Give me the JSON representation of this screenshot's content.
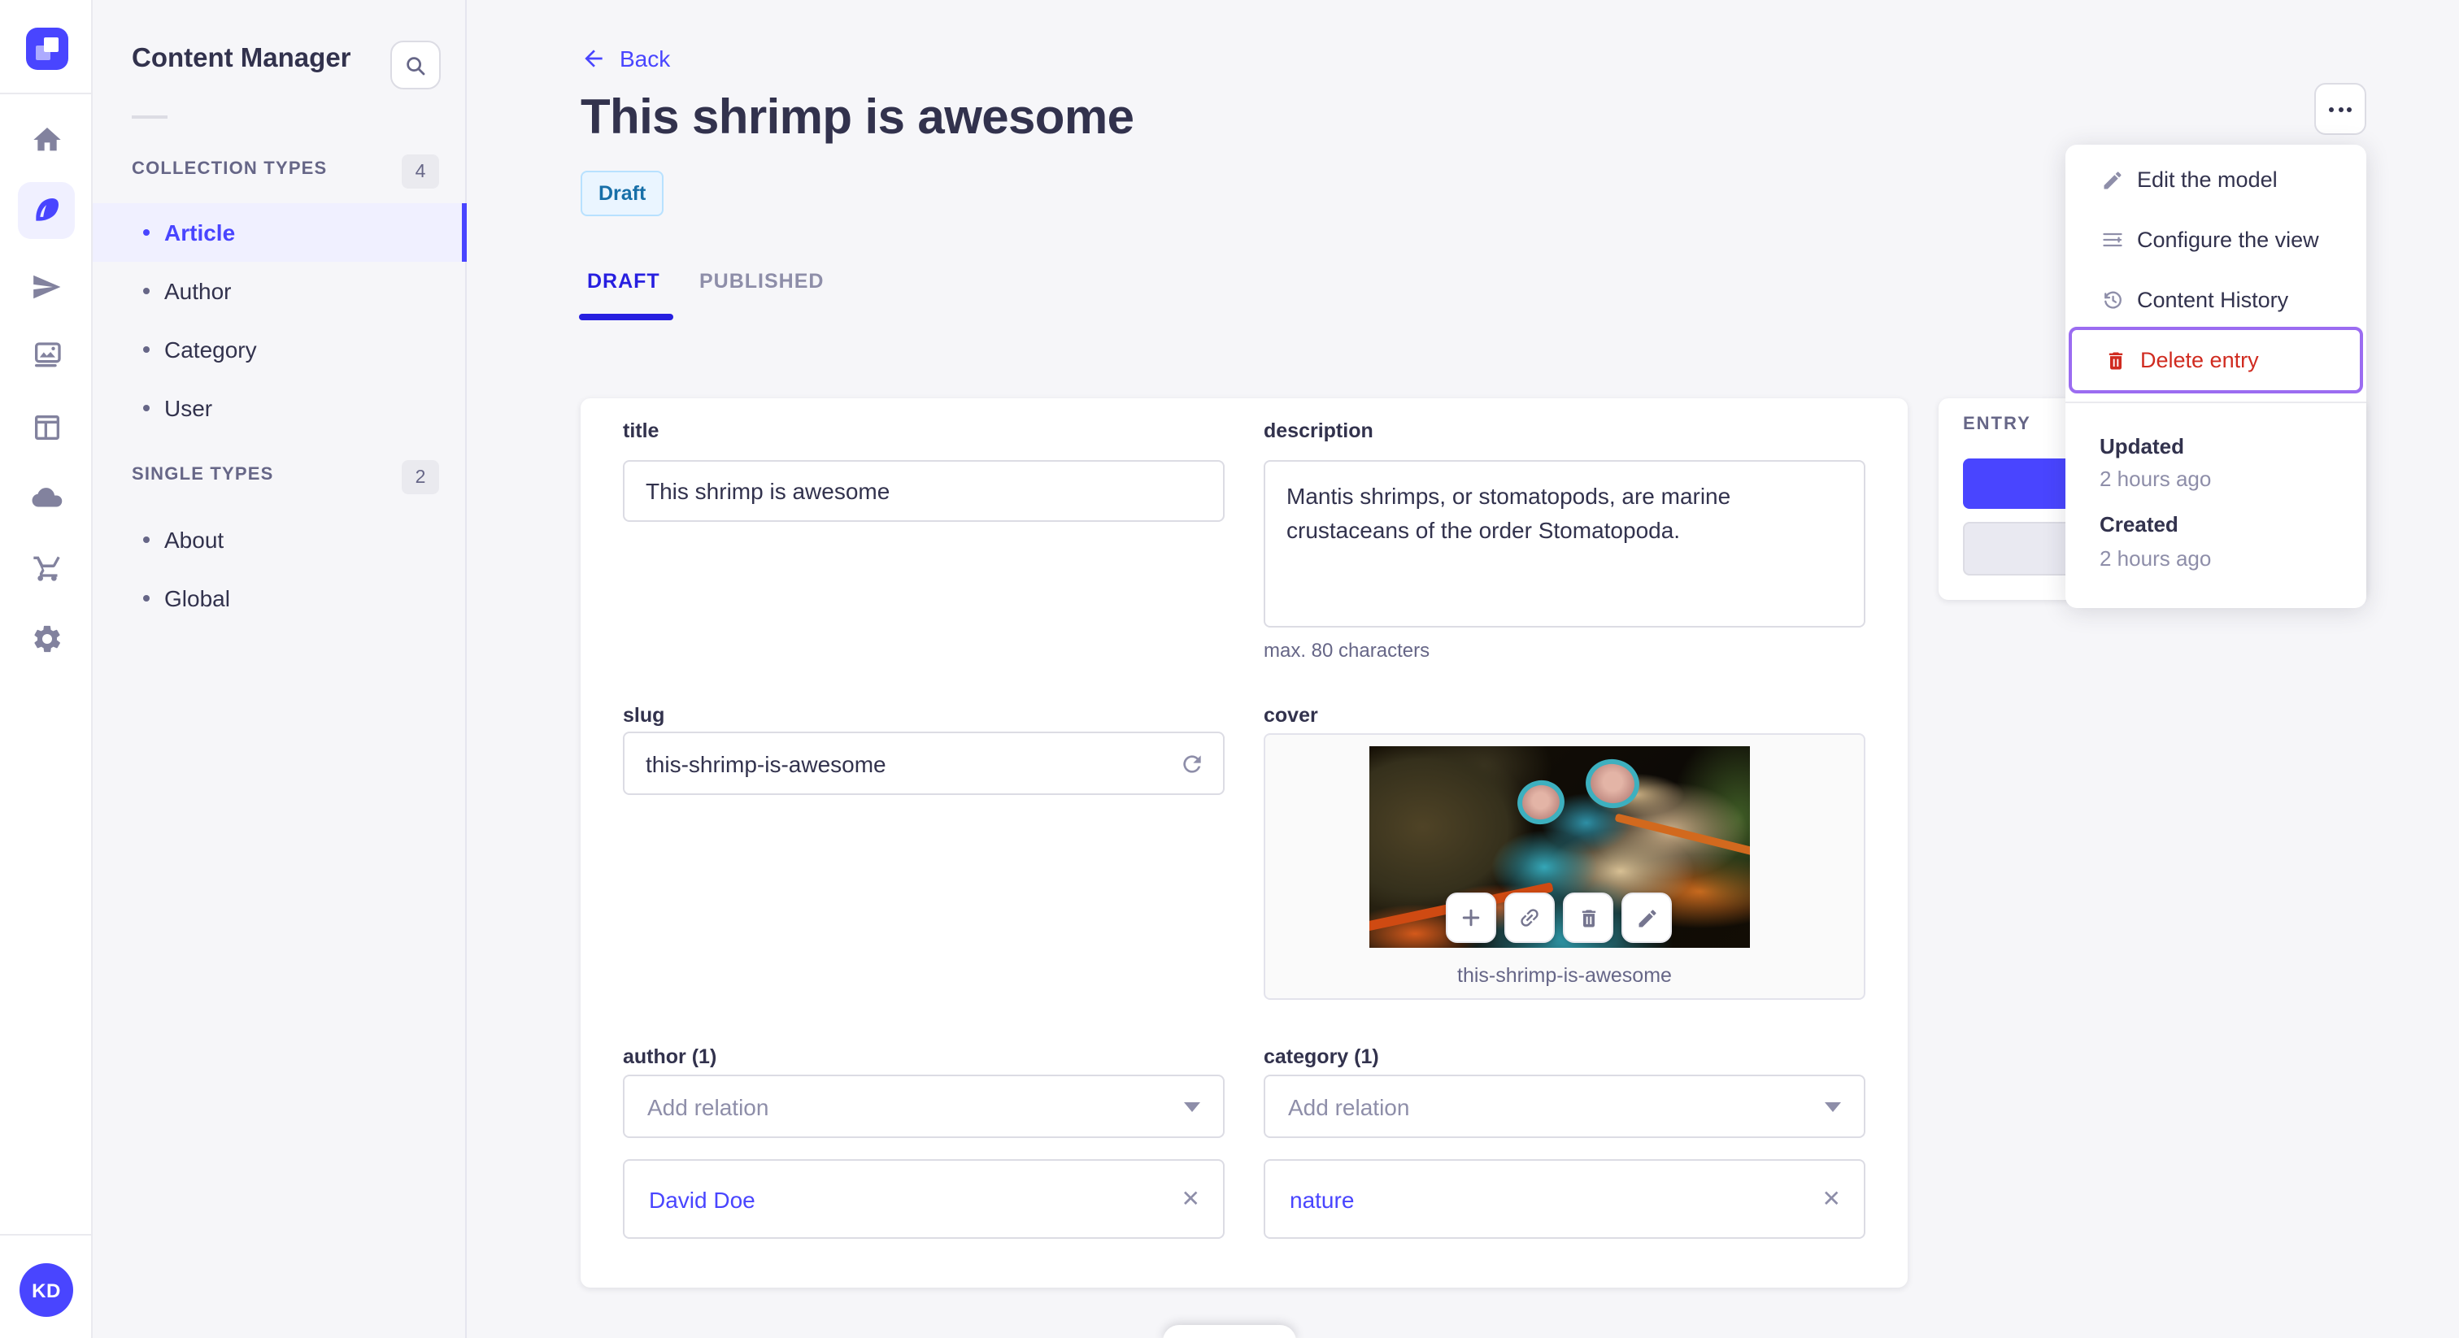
{
  "subnav": {
    "title": "Content Manager",
    "collection": {
      "label": "COLLECTION TYPES",
      "count": "4",
      "items": [
        {
          "label": "Article"
        },
        {
          "label": "Author"
        },
        {
          "label": "Category"
        },
        {
          "label": "User"
        }
      ]
    },
    "single": {
      "label": "SINGLE TYPES",
      "count": "2",
      "items": [
        {
          "label": "About"
        },
        {
          "label": "Global"
        }
      ]
    }
  },
  "header": {
    "back": "Back",
    "title": "This shrimp is awesome",
    "status": "Draft",
    "tab_draft": "DRAFT",
    "tab_published": "PUBLISHED"
  },
  "form": {
    "title": {
      "label": "title",
      "value": "This shrimp is awesome"
    },
    "description": {
      "label": "description",
      "value": "Mantis shrimps, or stomatopods, are marine crustaceans of the order Stomatopoda.",
      "hint": "max. 80 characters"
    },
    "slug": {
      "label": "slug",
      "value": "this-shrimp-is-awesome"
    },
    "cover": {
      "label": "cover",
      "caption": "this-shrimp-is-awesome"
    },
    "author": {
      "label": "author (1)",
      "placeholder": "Add relation",
      "relation": "David Doe",
      "remove": "✕"
    },
    "category": {
      "label": "category (1)",
      "placeholder": "Add relation",
      "relation": "nature",
      "remove": "✕"
    }
  },
  "entry": {
    "label": "ENTRY",
    "updated_label": "Updated",
    "updated_value": "2 hours ago",
    "created_label": "Created",
    "created_value": "2 hours ago"
  },
  "menu": {
    "items": [
      {
        "label": "Edit the model"
      },
      {
        "label": "Configure the view"
      },
      {
        "label": "Content History"
      },
      {
        "label": "Delete entry"
      }
    ]
  },
  "user": {
    "initials": "KD"
  },
  "colors": {
    "primary": "#4945ff",
    "danger": "#d02b20",
    "focus_purple": "#9b6cf1",
    "draft_bg": "#eaf5ff",
    "draft_text": "#176fa8"
  }
}
